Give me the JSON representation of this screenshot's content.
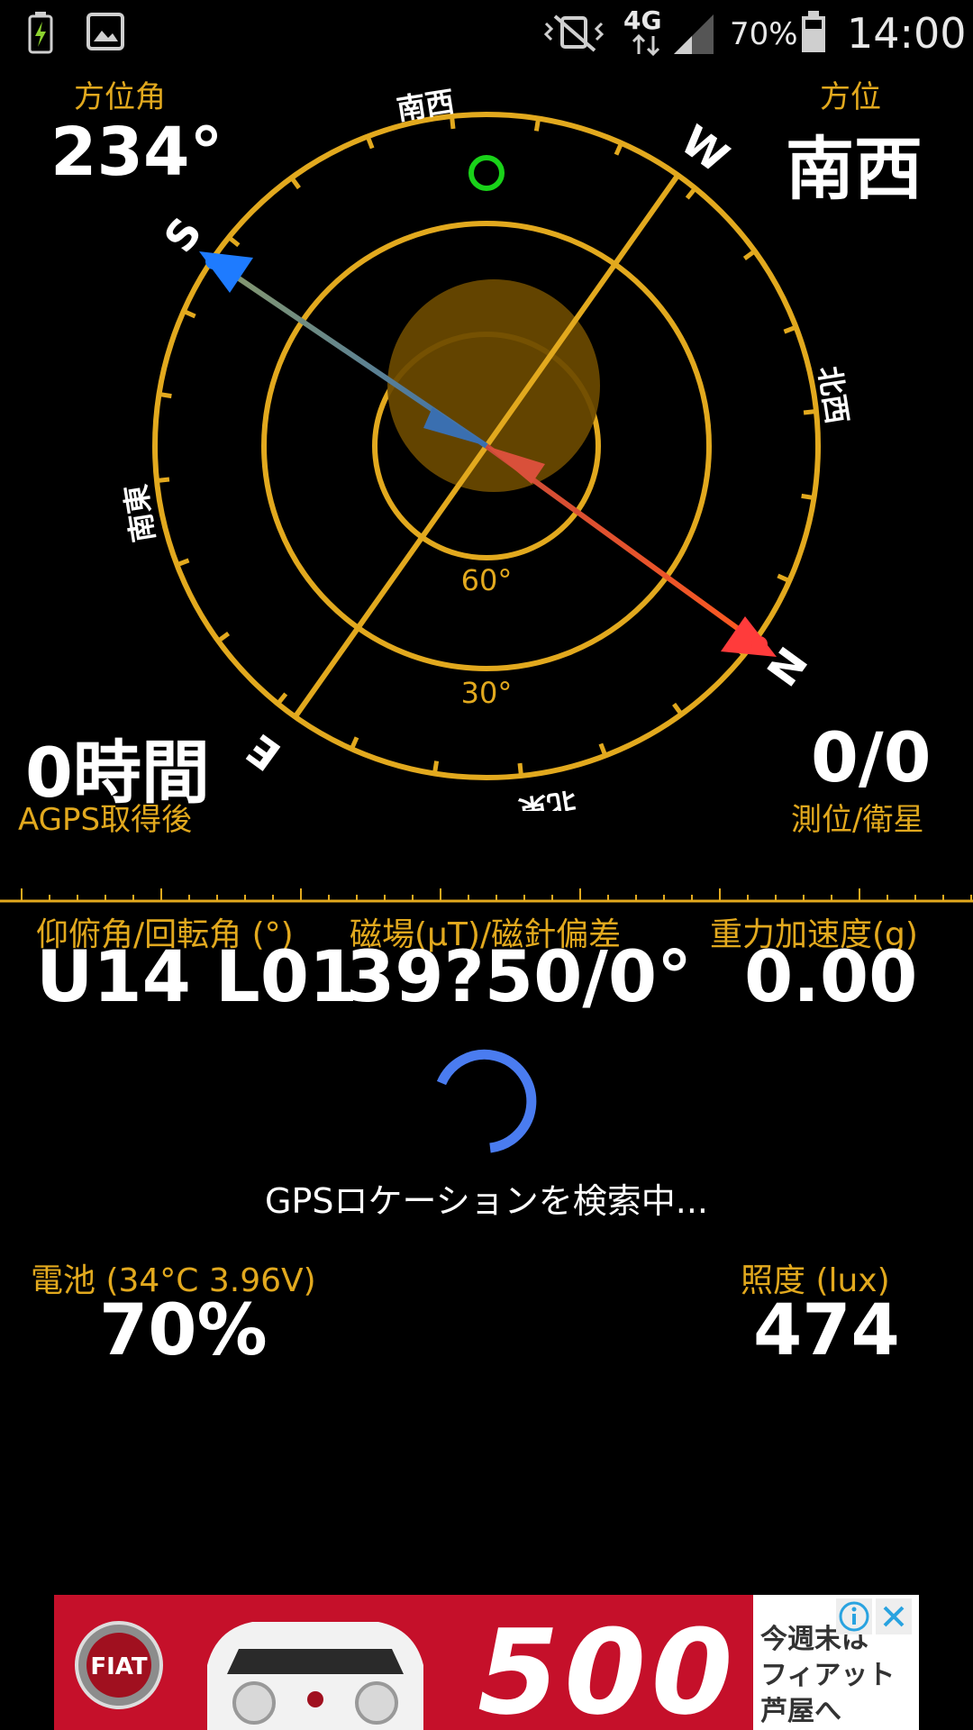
{
  "status_bar": {
    "battery_percent": "70%",
    "time": "14:00",
    "network": "4G",
    "icons": [
      "battery-charging-icon",
      "gallery-icon",
      "mute-vibrate-icon",
      "data-arrows-icon",
      "signal-icon",
      "battery-icon"
    ]
  },
  "azimuth": {
    "label": "方位角",
    "value": "234°"
  },
  "direction": {
    "label": "方位",
    "value": "南西"
  },
  "time_since": {
    "value": "0時間",
    "label": "AGPS取得後"
  },
  "fix": {
    "value": "0/0",
    "label": "測位/衛星"
  },
  "compass": {
    "cardinals": {
      "north": "N",
      "south": "S",
      "east": "E",
      "west": "W"
    },
    "intercardinals": {
      "southwest": "南西",
      "northwest": "北西",
      "northeast": "北東",
      "southeast": "南東"
    },
    "ring_labels": {
      "inner": "60°",
      "middle": "30°"
    },
    "colors": {
      "ring": "#E2A91E",
      "north_arrow": "#FF3B3B",
      "south_arrow": "#1E7BFF",
      "satellite_marker": "#19D219",
      "sun_disc": "#6B4A00"
    }
  },
  "tilt": {
    "label": "仰俯角/回転角 (°)",
    "value": "U14 L01"
  },
  "magnetic": {
    "label": "磁場(μT)/磁針偏差",
    "value": "39?50/0°"
  },
  "gravity": {
    "label": "重力加速度(g)",
    "value": "0.00"
  },
  "gps_status": {
    "text": "GPSロケーションを検索中..."
  },
  "battery": {
    "label": "電池 (34°C 3.96V)",
    "value": "70%"
  },
  "illuminance": {
    "label": "照度 (lux)",
    "value": "474"
  },
  "ad": {
    "brand": "FIAT",
    "model": "500",
    "side_text": [
      "今週末は",
      "フィアット",
      "芦屋へ"
    ],
    "info_icon": "info-icon",
    "close_icon": "close-icon"
  }
}
